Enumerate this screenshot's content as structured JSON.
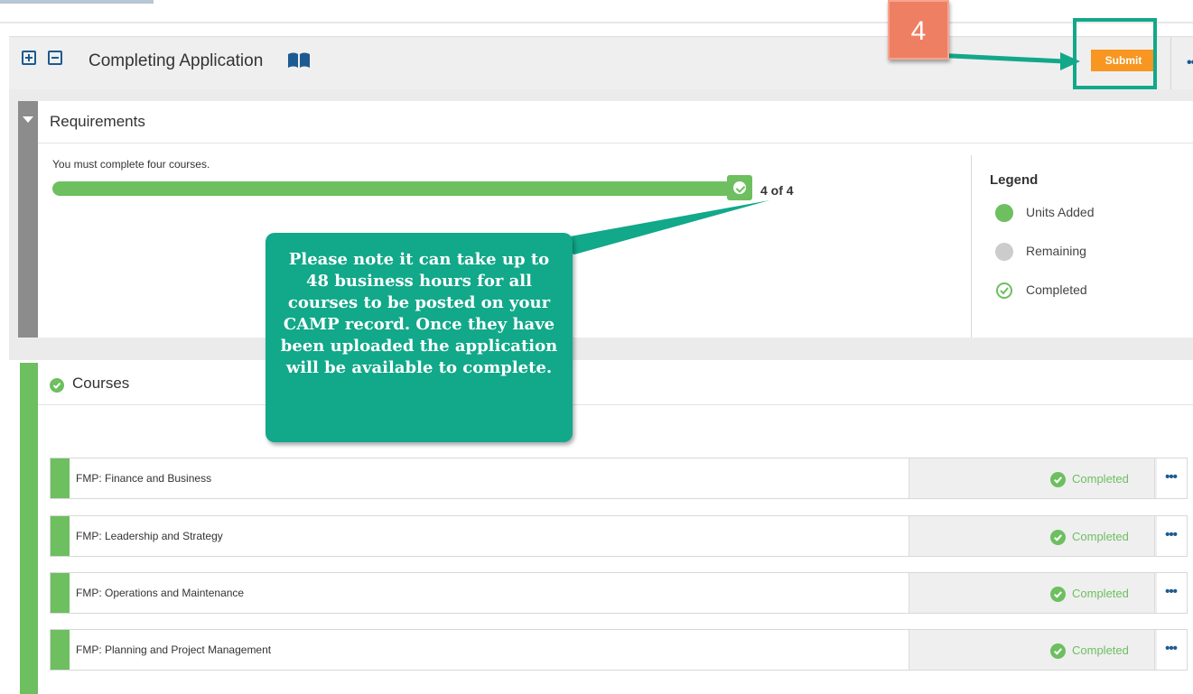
{
  "header": {
    "title": "Completing Application",
    "expand_icon": "plus-square-icon",
    "collapse_icon": "minus-square-icon",
    "guide_icon": "book-icon",
    "submit_label": "Submit",
    "more_label": "•••"
  },
  "requirements": {
    "title": "Requirements",
    "note": "You must complete four courses.",
    "progress_completed": 4,
    "progress_total": 4,
    "progress_label": "4 of 4",
    "legend": {
      "title": "Legend",
      "items": [
        {
          "label": "Units Added",
          "icon": "green-dot",
          "color": "#6dbf5f"
        },
        {
          "label": "Remaining",
          "icon": "grey-dot",
          "color": "#cccccc"
        },
        {
          "label": "Completed",
          "icon": "check-circle-icon",
          "color": "#6dbf5f"
        }
      ]
    }
  },
  "courses": {
    "title": "Courses",
    "items": [
      {
        "name": "FMP: Finance and Business",
        "status": "Completed"
      },
      {
        "name": "FMP: Leadership and Strategy",
        "status": "Completed"
      },
      {
        "name": "FMP: Operations and Maintenance",
        "status": "Completed"
      },
      {
        "name": "FMP: Planning and Project Management",
        "status": "Completed"
      }
    ],
    "more_label": "•••"
  },
  "annotation": {
    "step_number": "4",
    "callout_text": "Please note it can take up to 48 business hours for all courses to be posted on your CAMP record. Once they have been uploaded the application will be available to complete."
  },
  "colors": {
    "accent_green": "#6dbf5f",
    "submit_orange": "#f79620",
    "callout_teal": "#12a88a",
    "badge_salmon": "#ee7f62",
    "link_blue": "#1d5a91"
  }
}
